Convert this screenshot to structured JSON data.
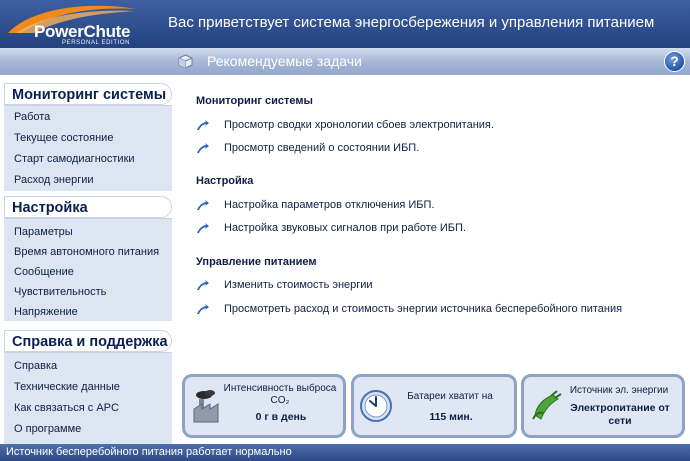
{
  "header": {
    "logo_text": "PowerChute",
    "logo_sub": "PERSONAL EDITION",
    "title": "Вас приветствует система энергосбережения и управления питанием"
  },
  "subheader": {
    "title": "Рекомендуемые задачи",
    "help_glyph": "?"
  },
  "sidebar": {
    "sections": [
      {
        "title": "Мониторинг системы",
        "items": [
          "Работа",
          "Текущее состояние",
          "Старт самодиагностики",
          "Расход энергии"
        ]
      },
      {
        "title": "Настройка",
        "items": [
          "Параметры",
          "Время автономного питания",
          "Сообщение",
          "Чувствительность",
          "Напряжение"
        ]
      },
      {
        "title": "Справка и поддержка",
        "items": [
          "Справка",
          "Технические данные",
          "Как связаться с APC",
          "О программе"
        ]
      }
    ]
  },
  "main": {
    "sections": [
      {
        "title": "Мониторинг системы",
        "tasks": [
          "Просмотр сводки хронологии сбоев электропитания.",
          "Просмотр сведений о состоянии ИБП."
        ]
      },
      {
        "title": "Настройка",
        "tasks": [
          "Настройка параметров отключения ИБП.",
          "Настройка звуковых сигналов при работе ИБП."
        ]
      },
      {
        "title": "Управление питанием",
        "tasks": [
          "Изменить стоимость энергии",
          "Просмотреть расход и стоимость энергии источника бесперебойного питания"
        ]
      }
    ]
  },
  "cards": [
    {
      "label_line1": "Интенсивность выброса",
      "label_line2": "CO₂",
      "value": "0 г в день",
      "icon": "factory-icon"
    },
    {
      "label_line1": "Батареи хватит на",
      "label_line2": "",
      "value": "115 мин.",
      "icon": "clock-icon"
    },
    {
      "label_line1": "Источник эл. энергии",
      "label_line2": "",
      "value": "Электропитание от сети",
      "icon": "plug-icon"
    }
  ],
  "statusbar": {
    "text": "Источник бесперебойного питания работает нормально"
  },
  "colors": {
    "header_bg": "#24427f",
    "accent_orange": "#f08a1c",
    "text_dark": "#0f1f45",
    "card_border": "#8ea2c6"
  }
}
